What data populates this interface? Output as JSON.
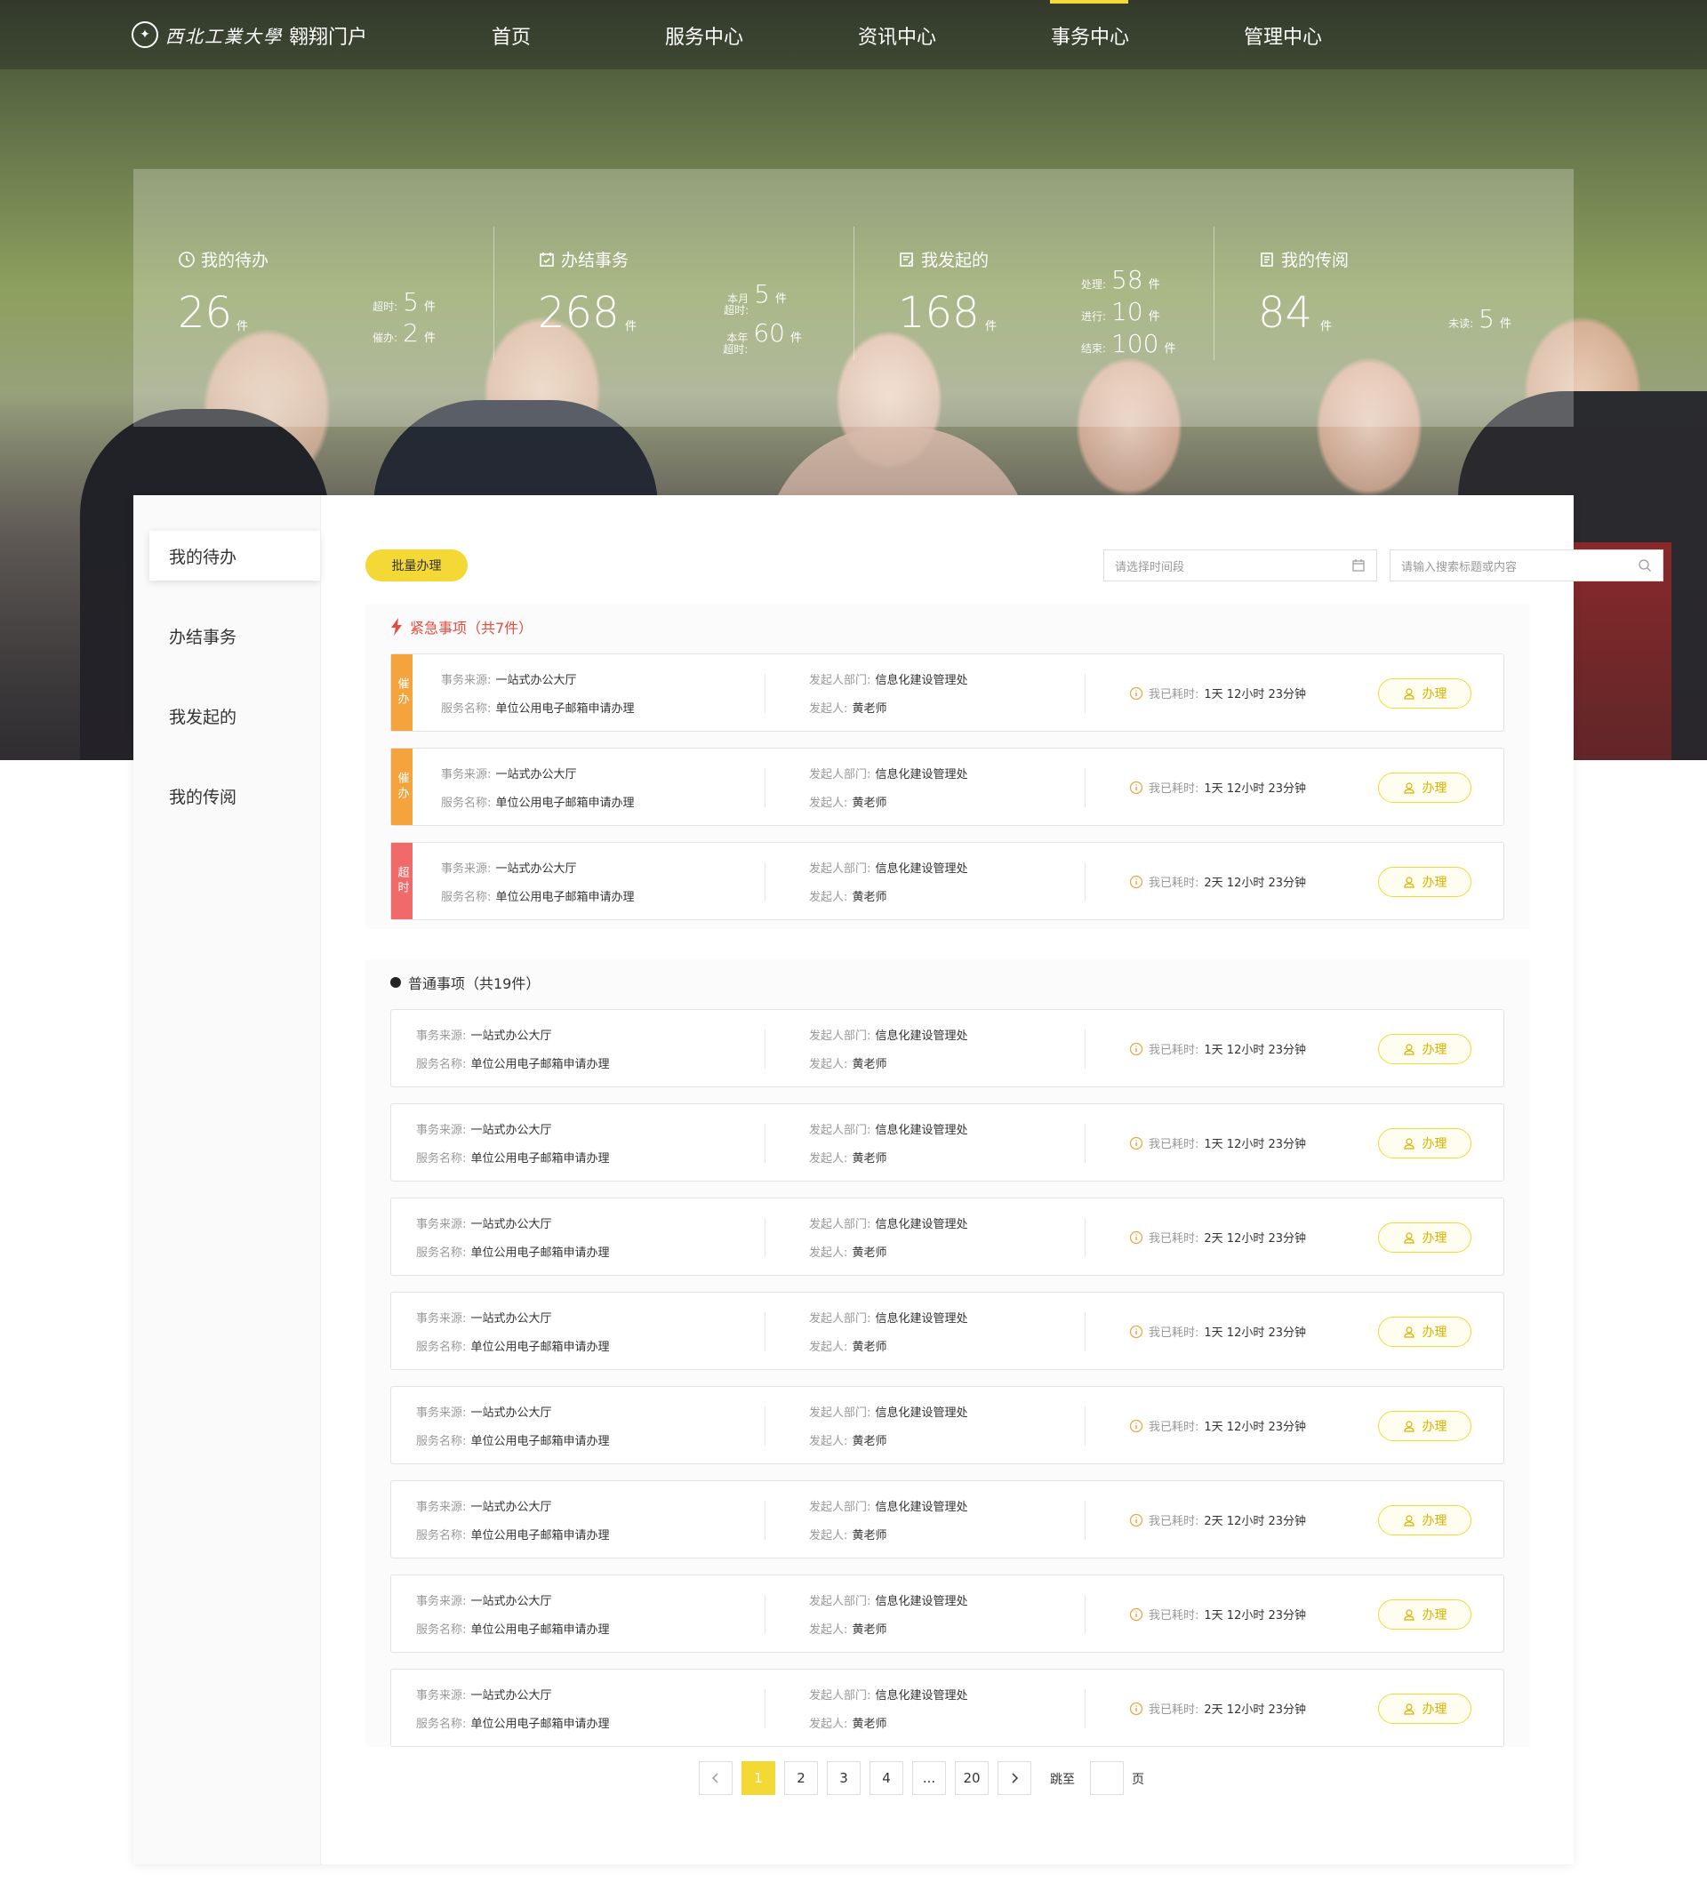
{
  "header": {
    "logo_text": "西北工業大學",
    "portal": "翱翔门户",
    "nav": [
      "首页",
      "服务中心",
      "资讯中心",
      "事务中心",
      "管理中心"
    ],
    "active_nav": "事务中心"
  },
  "stats": [
    {
      "title": "我的待办",
      "value": "26",
      "unit": "件",
      "subs": [
        {
          "label": "超时:",
          "value": "5",
          "unit": "件"
        },
        {
          "label": "催办:",
          "value": "2",
          "unit": "件"
        }
      ]
    },
    {
      "title": "办结事务",
      "value": "268",
      "unit": "件",
      "subs": [
        {
          "label": "本月超时:",
          "value": "5",
          "unit": "件"
        },
        {
          "label": "本年超时:",
          "value": "60",
          "unit": "件"
        }
      ]
    },
    {
      "title": "我发起的",
      "value": "168",
      "unit": "件",
      "subs": [
        {
          "label": "处理:",
          "value": "58",
          "unit": "件"
        },
        {
          "label": "进行:",
          "value": "10",
          "unit": "件"
        },
        {
          "label": "结束:",
          "value": "100",
          "unit": "件"
        }
      ]
    },
    {
      "title": "我的传阅",
      "value": "84",
      "unit": "件",
      "subs": [
        {
          "label": "未读:",
          "value": "5",
          "unit": "件"
        }
      ]
    }
  ],
  "sidebar": {
    "items": [
      "我的待办",
      "办结事务",
      "我发起的",
      "我的传阅"
    ],
    "active": "我的待办"
  },
  "toolbar": {
    "batch_label": "批量办理",
    "date_placeholder": "请选择时间段",
    "search_placeholder": "请输入搜索标题或内容"
  },
  "urgent": {
    "title": "紧急事项（共7件）",
    "rows": [
      {
        "tag": "催办",
        "tag_color": "#f5a33c",
        "source": "一站式办公大厅",
        "service": "单位公用电子邮箱申请办理",
        "dept": "信息化建设管理处",
        "initiator": "黄老师",
        "elapsed": "1天 12小时 23分钟"
      },
      {
        "tag": "催办",
        "tag_color": "#f5a33c",
        "source": "一站式办公大厅",
        "service": "单位公用电子邮箱申请办理",
        "dept": "信息化建设管理处",
        "initiator": "黄老师",
        "elapsed": "1天 12小时 23分钟"
      },
      {
        "tag": "超时",
        "tag_color": "#f06a6a",
        "source": "一站式办公大厅",
        "service": "单位公用电子邮箱申请办理",
        "dept": "信息化建设管理处",
        "initiator": "黄老师",
        "elapsed": "2天 12小时 23分钟"
      }
    ]
  },
  "normal": {
    "title": "普通事项（共19件）",
    "rows": [
      {
        "source": "一站式办公大厅",
        "service": "单位公用电子邮箱申请办理",
        "dept": "信息化建设管理处",
        "initiator": "黄老师",
        "elapsed": "1天 12小时 23分钟"
      },
      {
        "source": "一站式办公大厅",
        "service": "单位公用电子邮箱申请办理",
        "dept": "信息化建设管理处",
        "initiator": "黄老师",
        "elapsed": "1天 12小时 23分钟"
      },
      {
        "source": "一站式办公大厅",
        "service": "单位公用电子邮箱申请办理",
        "dept": "信息化建设管理处",
        "initiator": "黄老师",
        "elapsed": "2天 12小时 23分钟"
      },
      {
        "source": "一站式办公大厅",
        "service": "单位公用电子邮箱申请办理",
        "dept": "信息化建设管理处",
        "initiator": "黄老师",
        "elapsed": "1天 12小时 23分钟"
      },
      {
        "source": "一站式办公大厅",
        "service": "单位公用电子邮箱申请办理",
        "dept": "信息化建设管理处",
        "initiator": "黄老师",
        "elapsed": "1天 12小时 23分钟"
      },
      {
        "source": "一站式办公大厅",
        "service": "单位公用电子邮箱申请办理",
        "dept": "信息化建设管理处",
        "initiator": "黄老师",
        "elapsed": "2天 12小时 23分钟"
      },
      {
        "source": "一站式办公大厅",
        "service": "单位公用电子邮箱申请办理",
        "dept": "信息化建设管理处",
        "initiator": "黄老师",
        "elapsed": "1天 12小时 23分钟"
      },
      {
        "source": "一站式办公大厅",
        "service": "单位公用电子邮箱申请办理",
        "dept": "信息化建设管理处",
        "initiator": "黄老师",
        "elapsed": "2天 12小时 23分钟"
      }
    ]
  },
  "row_labels": {
    "source": "事务来源:",
    "service": "服务名称:",
    "dept": "发起人部门:",
    "initiator": "发起人:",
    "elapsed": "我已耗时:",
    "action": "办理"
  },
  "pagination": {
    "pages": [
      "1",
      "2",
      "3",
      "4",
      "...",
      "20"
    ],
    "current": "1",
    "jump_label": "跳至",
    "page_suffix": "页"
  },
  "colors": {
    "accent": "#f4d936",
    "urgent": "#e84a3f",
    "orange": "#f5a33c",
    "red": "#f06a6a"
  }
}
